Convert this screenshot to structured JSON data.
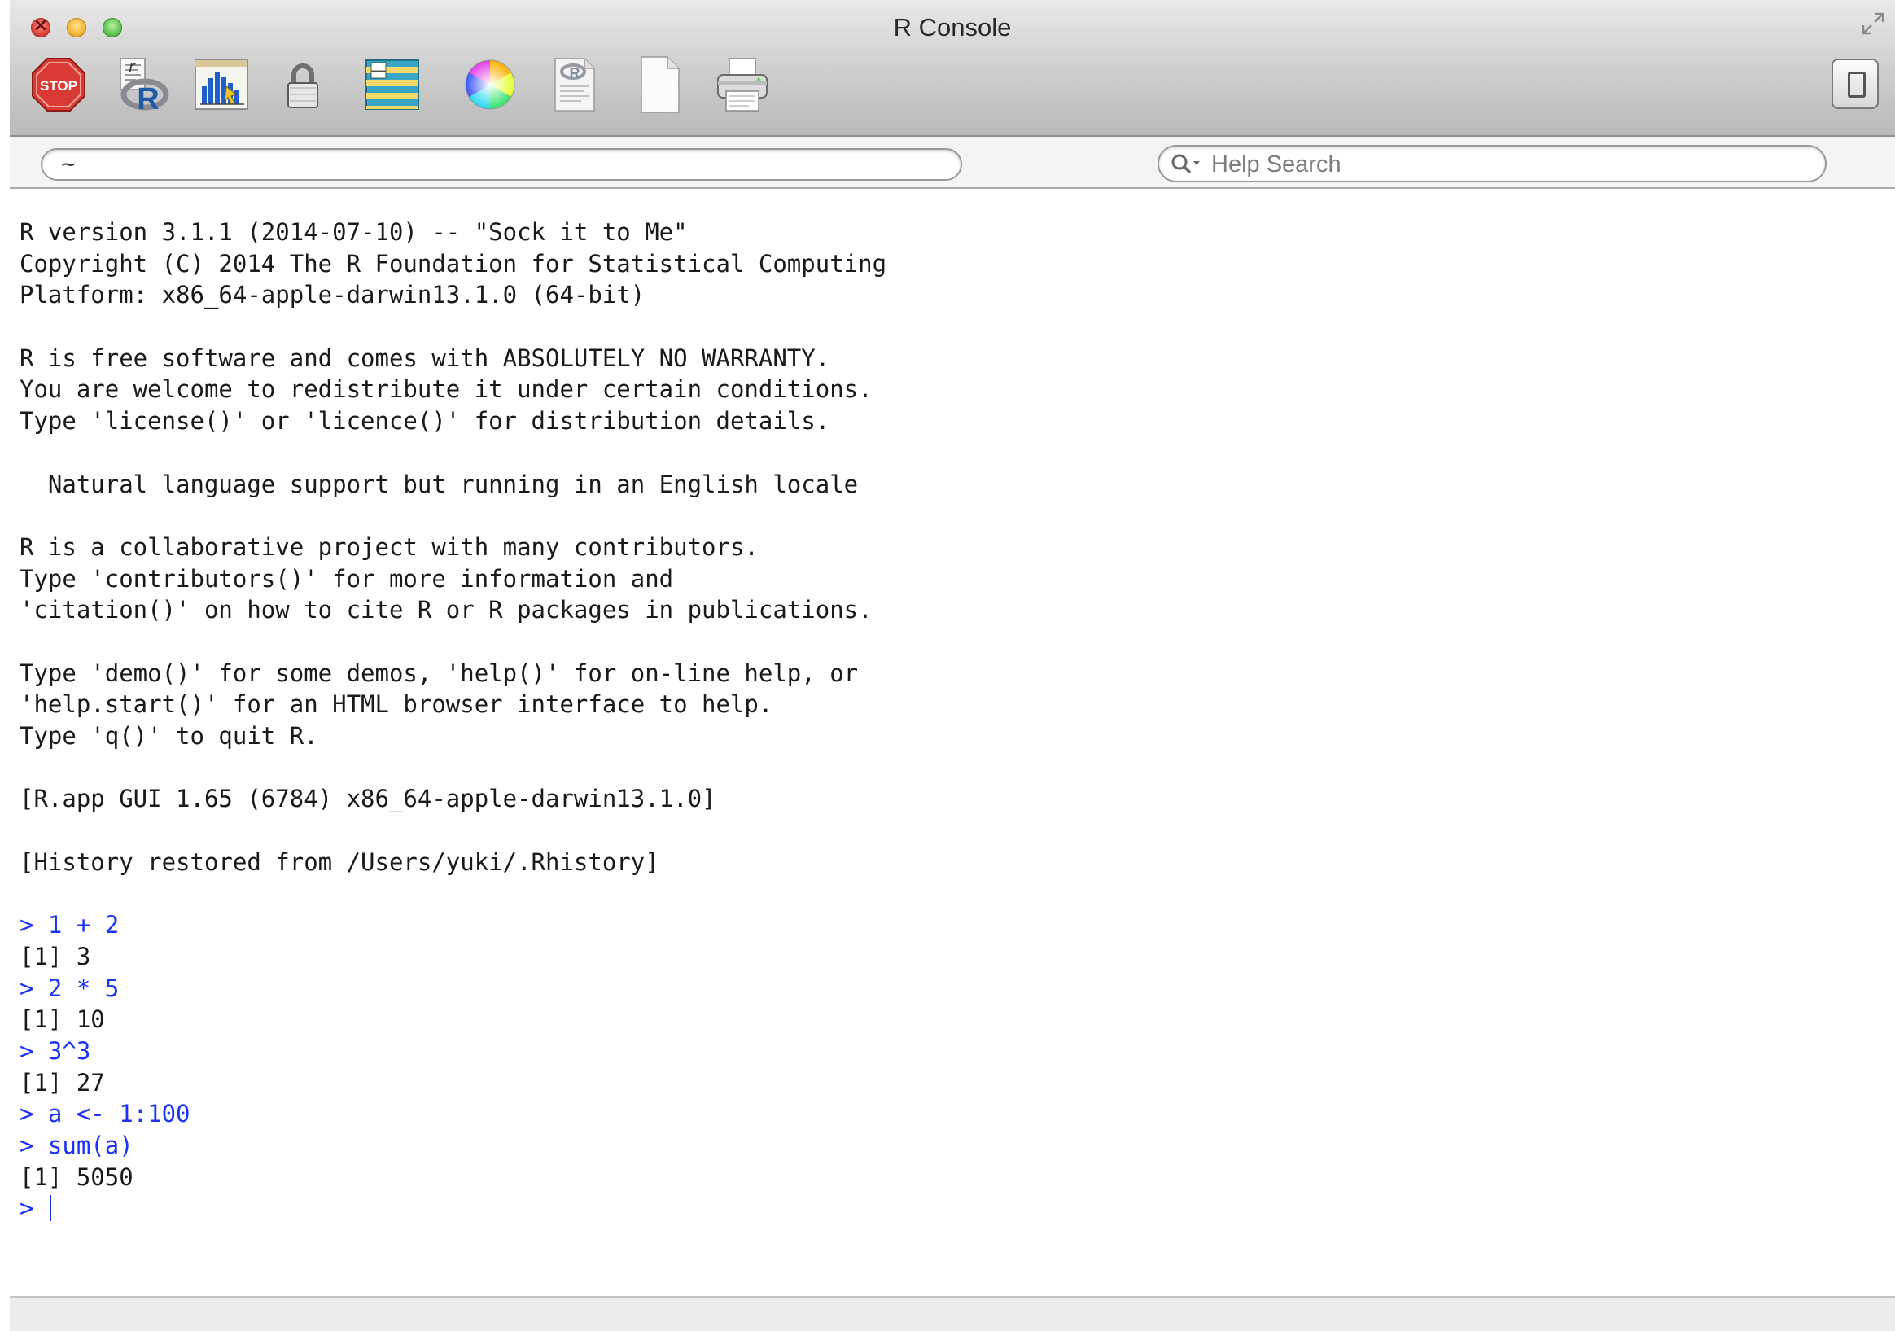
{
  "window": {
    "title": "R Console"
  },
  "toolbar": {
    "buttons": [
      {
        "name": "stop",
        "label": "STOP",
        "icon": "stop-sign-icon"
      },
      {
        "name": "source-script",
        "icon": "source-script-icon"
      },
      {
        "name": "quartz-plot",
        "icon": "quartz-plot-icon"
      },
      {
        "name": "authorize",
        "icon": "lock-icon"
      },
      {
        "name": "show-workspace",
        "icon": "data-table-icon"
      },
      {
        "name": "set-colors",
        "icon": "color-wheel-icon"
      },
      {
        "name": "open-document",
        "icon": "r-document-icon"
      },
      {
        "name": "new-document",
        "icon": "blank-document-icon"
      },
      {
        "name": "print",
        "icon": "printer-icon"
      }
    ]
  },
  "path_field": {
    "value": "~"
  },
  "help_search": {
    "placeholder": "Help Search"
  },
  "console": {
    "lines": [
      {
        "text": "R version 3.1.1 (2014-07-10) -- \"Sock it to Me\"",
        "kind": "output"
      },
      {
        "text": "Copyright (C) 2014 The R Foundation for Statistical Computing",
        "kind": "output"
      },
      {
        "text": "Platform: x86_64-apple-darwin13.1.0 (64-bit)",
        "kind": "output"
      },
      {
        "text": "",
        "kind": "blank"
      },
      {
        "text": "R is free software and comes with ABSOLUTELY NO WARRANTY.",
        "kind": "output"
      },
      {
        "text": "You are welcome to redistribute it under certain conditions.",
        "kind": "output"
      },
      {
        "text": "Type 'license()' or 'licence()' for distribution details.",
        "kind": "output"
      },
      {
        "text": "",
        "kind": "blank"
      },
      {
        "text": "  Natural language support but running in an English locale",
        "kind": "output"
      },
      {
        "text": "",
        "kind": "blank"
      },
      {
        "text": "R is a collaborative project with many contributors.",
        "kind": "output"
      },
      {
        "text": "Type 'contributors()' for more information and",
        "kind": "output"
      },
      {
        "text": "'citation()' on how to cite R or R packages in publications.",
        "kind": "output"
      },
      {
        "text": "",
        "kind": "blank"
      },
      {
        "text": "Type 'demo()' for some demos, 'help()' for on-line help, or",
        "kind": "output"
      },
      {
        "text": "'help.start()' for an HTML browser interface to help.",
        "kind": "output"
      },
      {
        "text": "Type 'q()' to quit R.",
        "kind": "output"
      },
      {
        "text": "",
        "kind": "blank"
      },
      {
        "text": "[R.app GUI 1.65 (6784) x86_64-apple-darwin13.1.0]",
        "kind": "output"
      },
      {
        "text": "",
        "kind": "blank"
      },
      {
        "text": "[History restored from /Users/yuki/.Rhistory]",
        "kind": "output"
      },
      {
        "text": "",
        "kind": "blank"
      },
      {
        "text": "> 1 + 2",
        "kind": "input"
      },
      {
        "text": "[1] 3",
        "kind": "output"
      },
      {
        "text": "> 2 * 5",
        "kind": "input"
      },
      {
        "text": "[1] 10",
        "kind": "output"
      },
      {
        "text": "> 3^3",
        "kind": "input"
      },
      {
        "text": "[1] 27",
        "kind": "output"
      },
      {
        "text": "> a <- 1:100",
        "kind": "input"
      },
      {
        "text": "> sum(a)",
        "kind": "input"
      },
      {
        "text": "[1] 5050",
        "kind": "output"
      }
    ],
    "prompt": "> "
  },
  "colors": {
    "input_text": "#1b33f5",
    "output_text": "#1a1a1a"
  }
}
